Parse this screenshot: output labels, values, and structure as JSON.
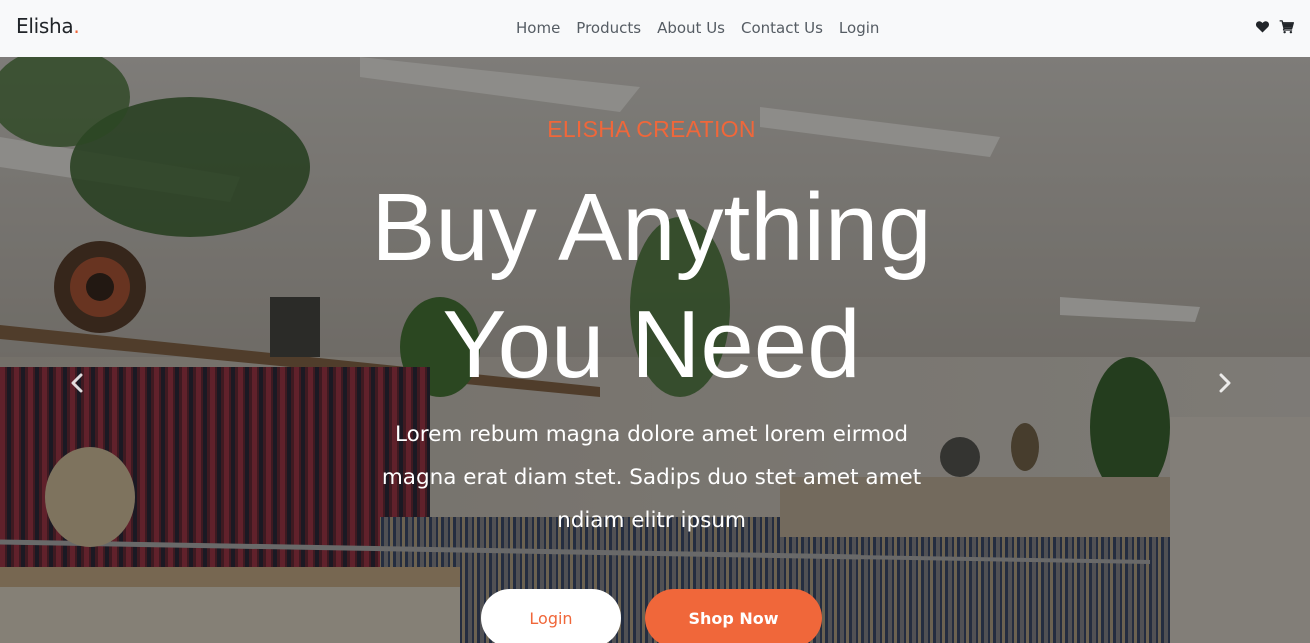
{
  "navbar": {
    "brand": "Elisha",
    "brand_dot": ".",
    "links": [
      {
        "label": "Home"
      },
      {
        "label": "Products"
      },
      {
        "label": "About Us"
      },
      {
        "label": "Contact Us"
      },
      {
        "label": "Login"
      }
    ],
    "icons": [
      {
        "name": "heart-icon"
      },
      {
        "name": "cart-icon"
      }
    ]
  },
  "hero": {
    "eyebrow": "ELISHA CREATION",
    "headline": "Buy Anything You Need",
    "lead": "Lorem rebum magna dolore amet lorem eirmod magna erat diam stet. Sadips duo stet amet amet ndiam elitr ipsum",
    "login_label": "Login",
    "shop_label": "Shop Now",
    "prev_icon": "chevron-left-icon",
    "next_icon": "chevron-right-icon"
  },
  "colors": {
    "accent": "#f0673a",
    "navbar_bg": "#f8f9fa",
    "text_dark": "#212529",
    "nav_text": "#555c63"
  }
}
